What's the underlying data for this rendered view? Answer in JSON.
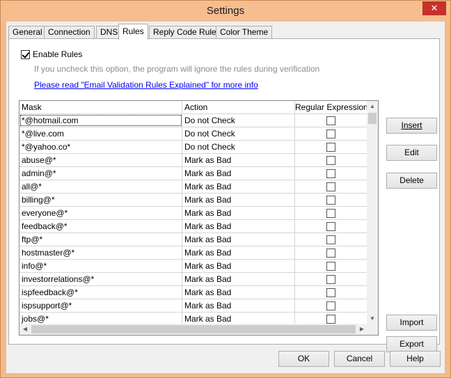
{
  "window": {
    "title": "Settings",
    "close_glyph": "✕"
  },
  "tabs": [
    {
      "label": "General",
      "active": false
    },
    {
      "label": "Connection",
      "active": false
    },
    {
      "label": "DNS",
      "active": false
    },
    {
      "label": "Rules",
      "active": true
    },
    {
      "label": "Reply Code Rules",
      "active": false
    },
    {
      "label": "Color Theme",
      "active": false
    }
  ],
  "rules": {
    "enable_label": "Enable Rules",
    "enable_checked": true,
    "hint": "If you uncheck this option, the program will ignore the rules during verification",
    "link": "Please read \"Email Validation Rules Explained\" for more info"
  },
  "grid": {
    "columns": [
      "Mask",
      "Action",
      "Regular Expression"
    ],
    "rows": [
      {
        "mask": "*@hotmail.com",
        "action": "Do not Check",
        "regex": false
      },
      {
        "mask": "*@live.com",
        "action": "Do not Check",
        "regex": false
      },
      {
        "mask": "*@yahoo.co*",
        "action": "Do not Check",
        "regex": false
      },
      {
        "mask": "abuse@*",
        "action": "Mark as Bad",
        "regex": false
      },
      {
        "mask": "admin@*",
        "action": "Mark as Bad",
        "regex": false
      },
      {
        "mask": "all@*",
        "action": "Mark as Bad",
        "regex": false
      },
      {
        "mask": "billing@*",
        "action": "Mark as Bad",
        "regex": false
      },
      {
        "mask": "everyone@*",
        "action": "Mark as Bad",
        "regex": false
      },
      {
        "mask": "feedback@*",
        "action": "Mark as Bad",
        "regex": false
      },
      {
        "mask": "ftp@*",
        "action": "Mark as Bad",
        "regex": false
      },
      {
        "mask": "hostmaster@*",
        "action": "Mark as Bad",
        "regex": false
      },
      {
        "mask": "info@*",
        "action": "Mark as Bad",
        "regex": false
      },
      {
        "mask": "investorrelations@*",
        "action": "Mark as Bad",
        "regex": false
      },
      {
        "mask": "ispfeedback@*",
        "action": "Mark as Bad",
        "regex": false
      },
      {
        "mask": "ispsupport@*",
        "action": "Mark as Bad",
        "regex": false
      },
      {
        "mask": "jobs@*",
        "action": "Mark as Bad",
        "regex": false
      }
    ]
  },
  "side_buttons": {
    "insert": "Insert",
    "edit": "Edit",
    "delete": "Delete",
    "import": "Import",
    "export": "Export"
  },
  "bottom_buttons": {
    "ok": "OK",
    "cancel": "Cancel",
    "help": "Help"
  },
  "scroll_glyphs": {
    "up": "▲",
    "down": "▼",
    "left": "◀",
    "right": "▶"
  }
}
